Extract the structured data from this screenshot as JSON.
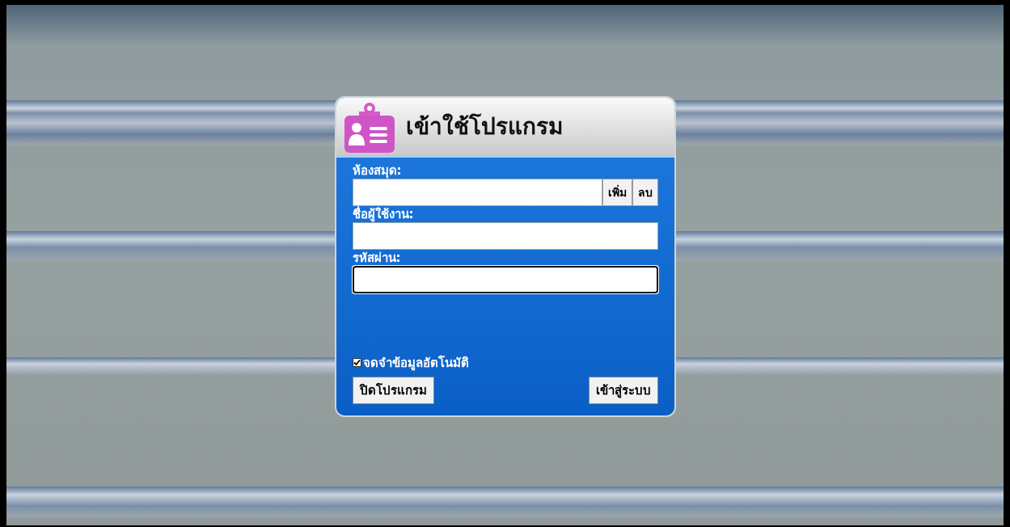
{
  "dialog": {
    "title": "เข้าใช้โปรแกรม",
    "fields": [
      {
        "kind": "with-buttons",
        "label": "ห้องสมุด:",
        "focused": false,
        "buttons": [
          "เพิ่ม",
          "ลบ"
        ]
      },
      {
        "kind": "text",
        "label": "ชื่อผู้ใช้งาน:",
        "focused": false
      },
      {
        "kind": "password",
        "label": "รหัสผ่าน:",
        "focused": true
      }
    ],
    "remember": {
      "label": "จดจำข้อมูลอัตโนมัติ",
      "checked": true
    },
    "buttons": [
      "ปิดโปรแกรม",
      "เข้าสู่ระบบ"
    ]
  }
}
